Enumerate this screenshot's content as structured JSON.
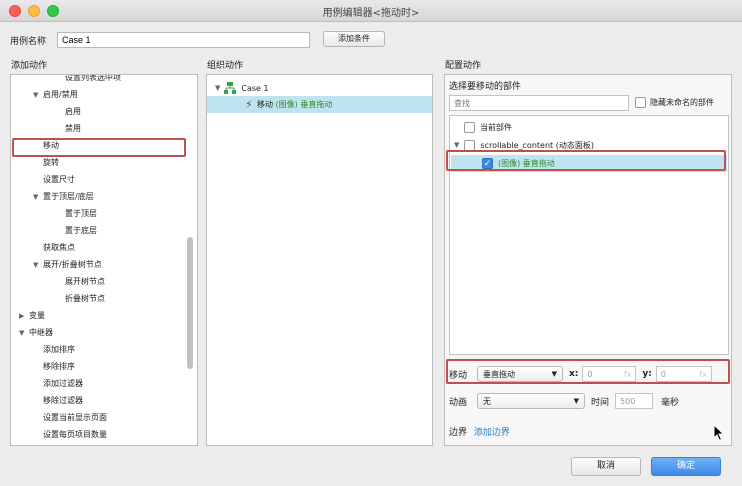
{
  "window": {
    "title": "用例编辑器<拖动时>"
  },
  "case": {
    "label": "用例名称",
    "value": "Case 1",
    "add_condition_label": "添加条件"
  },
  "left": {
    "title": "添加动作",
    "items": [
      {
        "label": "设置列表选中项",
        "indent": 2,
        "arrow": ""
      },
      {
        "label": "启用/禁用",
        "indent": 1,
        "arrow": "▼"
      },
      {
        "label": "启用",
        "indent": 2,
        "arrow": ""
      },
      {
        "label": "禁用",
        "indent": 2,
        "arrow": ""
      },
      {
        "label": "移动",
        "indent": 1,
        "arrow": ""
      },
      {
        "label": "旋转",
        "indent": 1,
        "arrow": ""
      },
      {
        "label": "设置尺寸",
        "indent": 1,
        "arrow": ""
      },
      {
        "label": "置于顶层/底层",
        "indent": 1,
        "arrow": "▼"
      },
      {
        "label": "置于顶层",
        "indent": 2,
        "arrow": ""
      },
      {
        "label": "置于底层",
        "indent": 2,
        "arrow": ""
      },
      {
        "label": "获取焦点",
        "indent": 1,
        "arrow": ""
      },
      {
        "label": "展开/折叠树节点",
        "indent": 1,
        "arrow": "▼"
      },
      {
        "label": "展开树节点",
        "indent": 2,
        "arrow": ""
      },
      {
        "label": "折叠树节点",
        "indent": 2,
        "arrow": ""
      },
      {
        "label": "变量",
        "indent": 0,
        "arrow": "▶"
      },
      {
        "label": "中继器",
        "indent": 0,
        "arrow": "▼"
      },
      {
        "label": "添加排序",
        "indent": 1,
        "arrow": ""
      },
      {
        "label": "移除排序",
        "indent": 1,
        "arrow": ""
      },
      {
        "label": "添加过滤器",
        "indent": 1,
        "arrow": ""
      },
      {
        "label": "移除过滤器",
        "indent": 1,
        "arrow": ""
      },
      {
        "label": "设置当前显示页面",
        "indent": 1,
        "arrow": ""
      },
      {
        "label": "设置每页项目数量",
        "indent": 1,
        "arrow": ""
      }
    ]
  },
  "middle": {
    "title": "组织动作",
    "case_label": "Case 1",
    "action_prefix": "移动",
    "action_detail": "(图像) 垂直拖动"
  },
  "right": {
    "title": "配置动作",
    "widget_label": "选择要移动的部件",
    "search_placeholder": "查找",
    "hide_unnamed_label": "隐藏未命名的部件",
    "tree": {
      "current": "当前部件",
      "parent": "scrollable_content (动态面板)",
      "child": "(图像) 垂直拖动"
    },
    "move_label": "移动",
    "move_mode": "垂直拖动",
    "x_label": "x:",
    "x_value": "0",
    "y_label": "y:",
    "y_value": "0",
    "fx": "fx",
    "anim_label": "动画",
    "anim_value": "无",
    "time_label": "时间",
    "time_value": "500",
    "ms_label": "毫秒",
    "boundary_label": "边界",
    "boundary_link": "添加边界"
  },
  "buttons": {
    "cancel": "取消",
    "ok": "确定"
  },
  "colors": {
    "highlight": "#c0504d",
    "selection": "#bfe3ef",
    "accent": "#3d8be9",
    "green_text": "#2e8b2e"
  }
}
